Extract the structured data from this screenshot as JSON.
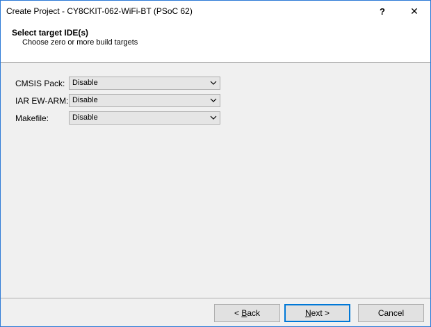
{
  "window": {
    "title": "Create Project - CY8CKIT-062-WiFi-BT (PSoC 62)",
    "help_glyph": "?",
    "close_glyph": "✕"
  },
  "header": {
    "title": "Select target IDE(s)",
    "subtitle": "Choose zero or more build targets"
  },
  "targets": [
    {
      "label": "CMSIS Pack:",
      "value": "Disable"
    },
    {
      "label": "IAR EW-ARM:",
      "value": "Disable"
    },
    {
      "label": "Makefile:",
      "value": "Disable"
    }
  ],
  "buttons": {
    "back_prefix": "< ",
    "back_mnemonic": "B",
    "back_rest": "ack",
    "next_mnemonic": "N",
    "next_rest": "ext >",
    "cancel": "Cancel"
  },
  "colors": {
    "accent": "#0078d7",
    "window_border": "#2b79d6",
    "dialog_bg": "#f0f0f0"
  }
}
